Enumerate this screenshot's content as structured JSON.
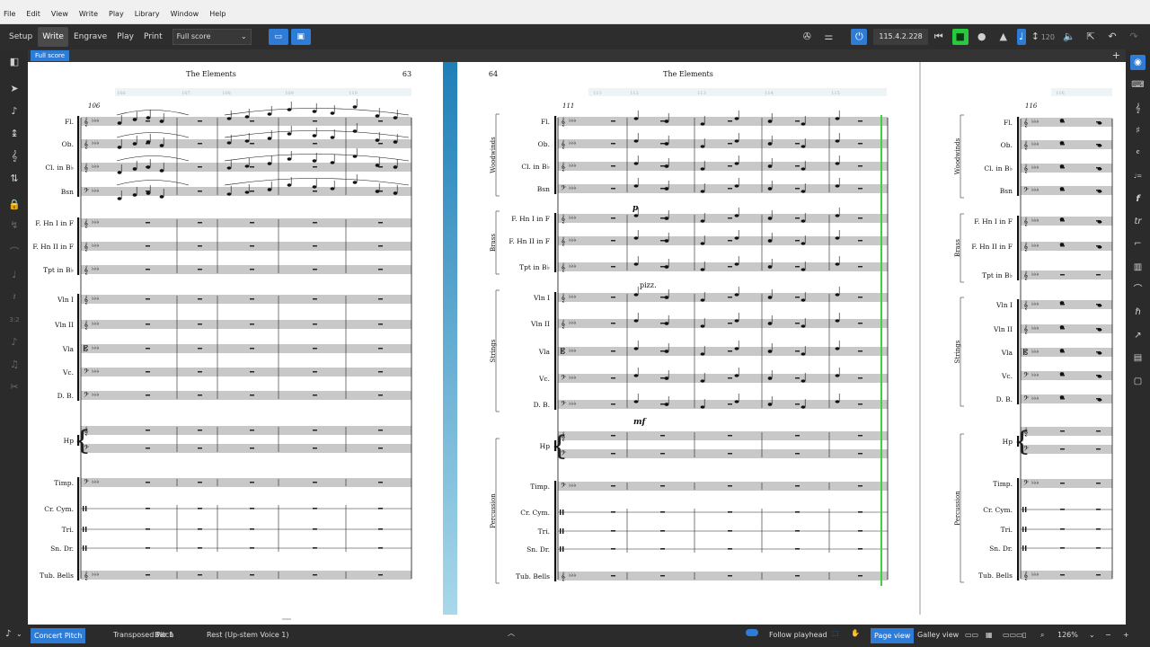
{
  "menu": {
    "items": [
      "File",
      "Edit",
      "View",
      "Write",
      "Play",
      "Library",
      "Window",
      "Help"
    ]
  },
  "toolbar": {
    "modes": [
      "Setup",
      "Write",
      "Engrave",
      "Play",
      "Print"
    ],
    "active_mode": "Write",
    "layout_select": "Full score",
    "position": "115.4.2.228",
    "tempo": "120"
  },
  "tabs": {
    "active": "Full score"
  },
  "score": {
    "title": "The Elements",
    "pages": [
      {
        "number": "63",
        "first_bar": "106",
        "bars": [
          "106",
          "107",
          "108",
          "109",
          "110"
        ]
      },
      {
        "number": "64",
        "first_bar": "111",
        "bars": [
          "111",
          "112",
          "113",
          "114",
          "115"
        ]
      },
      {
        "number": "",
        "first_bar": "116",
        "bars": [
          "116"
        ]
      }
    ],
    "instruments": [
      "Fl.",
      "Ob.",
      "Cl. in B♭",
      "Bsn",
      "F. Hn I in F",
      "F. Hn II in F",
      "Tpt in B♭",
      "Vln I",
      "Vln II",
      "Vla",
      "Vc.",
      "D. B.",
      "Hp",
      "Timp.",
      "Cr. Cym.",
      "Tri.",
      "Sn. Dr.",
      "Tub. Bells"
    ],
    "groups": [
      "Woodwinds",
      "Brass",
      "Strings",
      "Percussion"
    ],
    "markings": {
      "pizz": "pizz.",
      "mf": "mf",
      "p": "p"
    }
  },
  "status": {
    "concert_pitch": "Concert Pitch",
    "transposed_pitch": "Transposed Pitch",
    "bar": "Bar 1",
    "selection": "Rest (Up-stem Voice 1)",
    "follow_playhead": "Follow playhead",
    "page_view": "Page view",
    "galley_view": "Galley view",
    "zoom": "126%"
  },
  "colors": {
    "accent": "#2f7cd6",
    "record_green": "#27c93f",
    "playhead_green": "#3bd43b",
    "page_gap_blue": "#3aa0cc"
  }
}
